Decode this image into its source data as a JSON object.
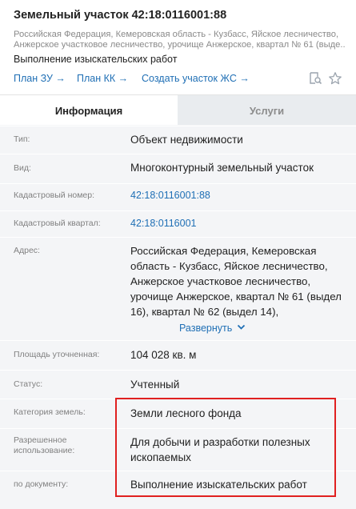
{
  "header": {
    "title": "Земельный участок 42:18:0116001:88",
    "address_line1": "Российская Федерация, Кемеровская область - Кузбасс, Яйское лесничество,",
    "address_line2": "Анжерское участковое лесничество, урочище Анжерское, квартал № 61 (выде...",
    "purpose": "Выполнение изыскательских работ",
    "links": {
      "plan_zu": "План ЗУ →",
      "plan_kk": "План КК →",
      "create_zhs": "Создать участок ЖС →"
    },
    "icons": [
      "search-document-icon",
      "star-icon"
    ]
  },
  "tabs": {
    "info": "Информация",
    "services": "Услуги",
    "active": "info"
  },
  "rows": {
    "type": {
      "label": "Тип:",
      "value": "Объект недвижимости"
    },
    "kind": {
      "label": "Вид:",
      "value": "Многоконтурный земельный участок"
    },
    "cad_number": {
      "label": "Кадастровый номер:",
      "value": "42:18:0116001:88"
    },
    "cad_quarter": {
      "label": "Кадастровый квартал:",
      "value": "42:18:0116001"
    },
    "address": {
      "label": "Адрес:",
      "value": "Российская Федерация, Кемеровская область - Кузбасс, Яйское лесничество, Анжерское участковое лесничество, урочище Анжерское, квартал № 61 (выдел 16), квартал № 62 (выдел 14),",
      "expand": "Развернуть"
    },
    "area": {
      "label": "Площадь уточненная:",
      "value": "104 028 кв. м"
    },
    "status": {
      "label": "Статус:",
      "value": "Учтенный"
    },
    "land_category": {
      "label": "Категория земель:",
      "value": "Земли лесного фонда"
    },
    "permitted_use": {
      "label_line1": "Разрешенное",
      "label_line2": "использование:",
      "value_line1": "Для добычи и разработки полезных",
      "value_line2": "ископаемых"
    },
    "by_document": {
      "label": "по документу:",
      "value": "Выполнение изыскательских работ"
    }
  },
  "colors": {
    "link": "#1f6fb5",
    "highlight": "#e02020",
    "content_bg": "#f4f5f7"
  }
}
